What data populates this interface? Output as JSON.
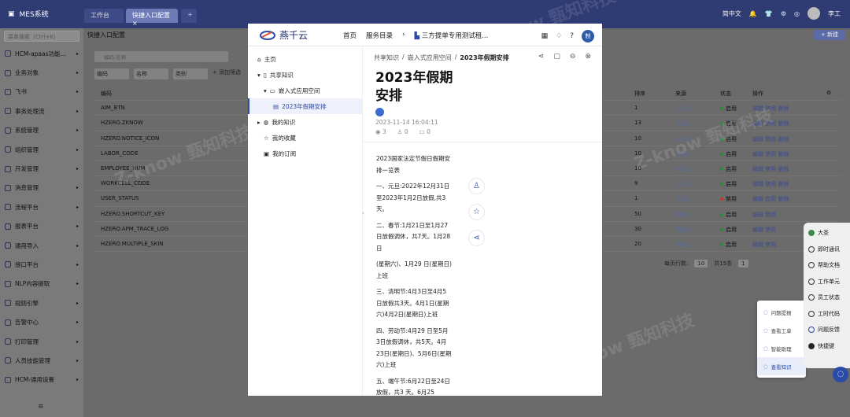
{
  "topbar": {
    "app_name": "MES系统",
    "tabs": [
      "工作台",
      "快捷入口配置"
    ],
    "tab_close": "×",
    "tab_add": "+",
    "site": "简中文",
    "user": "李工"
  },
  "sidebar": {
    "search_placeholder": "菜单搜索（Ctrl+K）",
    "items": [
      {
        "label": "HCM-apaas功能..."
      },
      {
        "label": "业务对象"
      },
      {
        "label": "飞书"
      },
      {
        "label": "事务处理流"
      },
      {
        "label": "系统管理"
      },
      {
        "label": "组织管理"
      },
      {
        "label": "开发管理"
      },
      {
        "label": "消息管理"
      },
      {
        "label": "流程平台"
      },
      {
        "label": "报表平台"
      },
      {
        "label": "通用导入"
      },
      {
        "label": "接口平台"
      },
      {
        "label": "NLP内容提取"
      },
      {
        "label": "规则引擎"
      },
      {
        "label": "告警中心"
      },
      {
        "label": "打印管理"
      },
      {
        "label": "人员技能管理"
      },
      {
        "label": "HCM-通用设置"
      }
    ],
    "collapse_icon": "≡"
  },
  "main": {
    "title": "快捷入口配置",
    "new_button": "+ 新建",
    "search_placeholder": "编码,名称",
    "filters": [
      "编码",
      "名称",
      "类别",
      "+ 添加筛选"
    ],
    "columns": [
      "编码",
      "排序",
      "来源",
      "状态",
      "操作"
    ],
    "rows": [
      {
        "code": "AIM_BTN",
        "seq": "1",
        "source": "自定义",
        "status": "启用",
        "ops": "编辑  禁用  删除"
      },
      {
        "code": "HZERO.ZKNOW",
        "seq": "13",
        "source": "自定义",
        "status": "启用",
        "ops": "编辑  禁用  删除"
      },
      {
        "code": "HZERO.NOTICE_ICON",
        "seq": "10",
        "source": "自定义",
        "status": "启用",
        "ops": "编辑  禁用  删除"
      },
      {
        "code": "LABOR_CODE",
        "seq": "10",
        "source": "自定义",
        "status": "启用",
        "ops": "编辑  禁用  删除"
      },
      {
        "code": "EMPLOYEE_NUM",
        "seq": "10",
        "source": "自定义",
        "status": "启用",
        "ops": "编辑  禁用  删除"
      },
      {
        "code": "WORKCELL_CODE",
        "seq": "9",
        "source": "自定义",
        "status": "启用",
        "ops": "编辑  禁用  删除"
      },
      {
        "code": "USER_STATUS",
        "seq": "1",
        "source": "自定义",
        "status": "禁用",
        "ops": "编辑  启用  删除"
      },
      {
        "code": "HZERO.SHORTCUT_KEY",
        "seq": "50",
        "source": "预定义",
        "status": "启用",
        "ops": "编辑  禁用"
      },
      {
        "code": "HZERO.APM_TRACE_LOG",
        "seq": "30",
        "source": "预定义",
        "status": "启用",
        "ops": "编辑  禁用"
      },
      {
        "code": "HZERO.MULTIPLE_SKIN",
        "seq": "20",
        "source": "预定义",
        "status": "启用",
        "ops": "编辑  禁用"
      }
    ],
    "pager": {
      "page_size_label": "每页行数:",
      "page_size": "10",
      "total": "共15条",
      "page": "1"
    }
  },
  "dialog": {
    "logo_text": "燕千云",
    "nav": [
      "首页",
      "服务目录",
      "三方提单专用测试租..."
    ],
    "avatar_text": "制",
    "tree": [
      {
        "label": "主页"
      },
      {
        "label": "共享知识"
      },
      {
        "label": "嵌入式应用空间"
      },
      {
        "label": "2023年假期安排"
      },
      {
        "label": "我的知识"
      },
      {
        "label": "我的收藏"
      },
      {
        "label": "我的订阅"
      }
    ],
    "breadcrumb": [
      "共享知识",
      "嵌入式应用空间",
      "2023年假期安排"
    ],
    "article": {
      "title": "2023年假期安排",
      "date": "2023-11-14 16:04:11",
      "views": "3",
      "likes": "0",
      "comments": "0",
      "paragraphs": [
        "2023国家法定节假日假期安排一览表",
        "一、元旦:2022年12月31日至2023年1月2日放假,共3天。",
        "二、春节:1月21日至1月27日放假调休，共7天。1月28 日",
        "(星期六)、1月29 日(星期日)上班",
        "三、清明节:4月3日至4月5日放假共3天。4月1日(星期六)4月2日(星期日)上班",
        "四、劳动节:4月29 日至5月3日放假调休，共5天。4月23日(星期日)、5月6日(星期六)上班",
        "五、端午节:6月22日至24日放假，共3 天。6月25"
      ]
    }
  },
  "float_menu": [
    "问题提报",
    "查看工单",
    "智能助理",
    "查看知识"
  ],
  "right_panel": [
    "大圣",
    "即时通讯",
    "帮助文档",
    "工作单元",
    "员工状态",
    "工时代码",
    "问题反馈",
    "快捷键"
  ],
  "watermark": "Z-know 甄知科技",
  "colors": {
    "topbar": "#2f3b73",
    "accent": "#2c4aa8",
    "enabled": "#2a8a3c",
    "disabled": "#c0392b"
  }
}
